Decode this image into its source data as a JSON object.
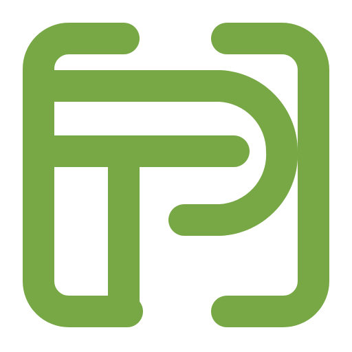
{
  "logo": {
    "icon": "fp-monogram-logo-icon",
    "accent_color": "#78A846",
    "background_color": "#FFFFFF"
  }
}
